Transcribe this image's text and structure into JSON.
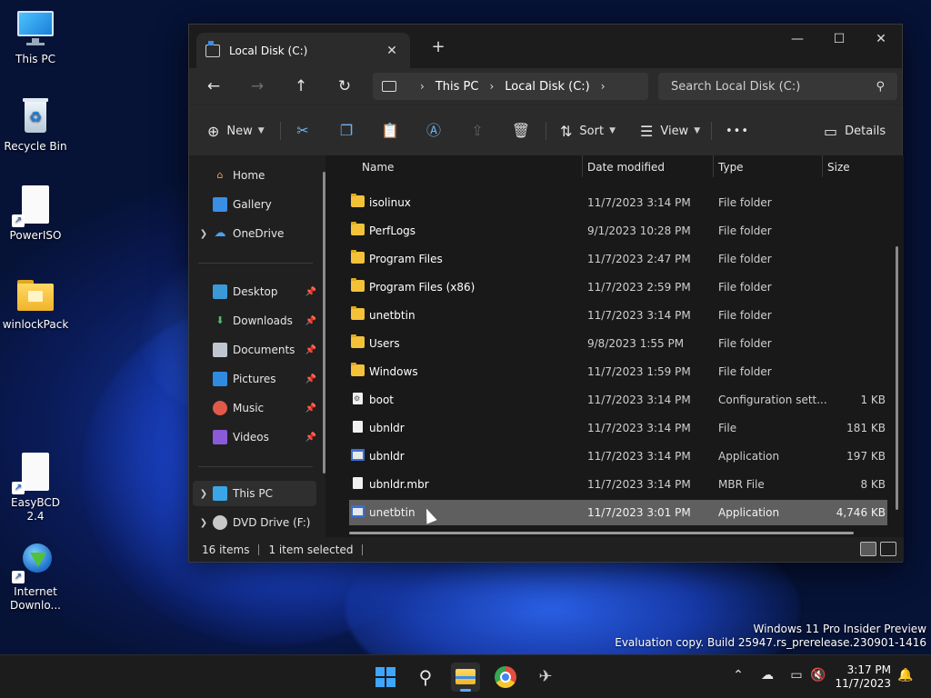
{
  "desktop": {
    "icons": [
      {
        "label": "This PC"
      },
      {
        "label": "Recycle Bin"
      },
      {
        "label": "PowerISO"
      },
      {
        "label": "winlockPack"
      },
      {
        "label": "EasyBCD 2.4"
      },
      {
        "label": "Internet Downlo..."
      }
    ],
    "watermark": {
      "line1": "Windows 11 Pro Insider Preview",
      "line2": "Evaluation copy. Build 25947.rs_prerelease.230901-1416"
    }
  },
  "window": {
    "tab_title": "Local Disk (C:)",
    "tab_close": "✕",
    "new_tab": "+",
    "controls": {
      "minimize": "—",
      "maximize": "☐",
      "close": "✕"
    },
    "nav": {
      "back": "←",
      "forward": "→",
      "up": "↑",
      "refresh": "↻"
    },
    "breadcrumb": [
      "This PC",
      "Local Disk (C:)"
    ],
    "breadcrumb_sep": "›",
    "search_placeholder": "Search Local Disk (C:)",
    "commands": {
      "new": "New",
      "sort": "Sort",
      "view": "View",
      "more": "•••",
      "details": "Details"
    },
    "navpane": {
      "home": "Home",
      "gallery": "Gallery",
      "onedrive": "OneDrive",
      "desktop": "Desktop",
      "downloads": "Downloads",
      "documents": "Documents",
      "pictures": "Pictures",
      "music": "Music",
      "videos": "Videos",
      "thispc": "This PC",
      "dvd": "DVD Drive (F:) sł"
    },
    "columns": {
      "name": "Name",
      "date": "Date modified",
      "type": "Type",
      "size": "Size"
    },
    "files": [
      {
        "name": "isolinux",
        "date": "11/7/2023 3:14 PM",
        "type": "File folder",
        "size": "",
        "icon": "folder"
      },
      {
        "name": "PerfLogs",
        "date": "9/1/2023 10:28 PM",
        "type": "File folder",
        "size": "",
        "icon": "folder"
      },
      {
        "name": "Program Files",
        "date": "11/7/2023 2:47 PM",
        "type": "File folder",
        "size": "",
        "icon": "folder"
      },
      {
        "name": "Program Files (x86)",
        "date": "11/7/2023 2:59 PM",
        "type": "File folder",
        "size": "",
        "icon": "folder"
      },
      {
        "name": "unetbtin",
        "date": "11/7/2023 3:14 PM",
        "type": "File folder",
        "size": "",
        "icon": "folder"
      },
      {
        "name": "Users",
        "date": "9/8/2023 1:55 PM",
        "type": "File folder",
        "size": "",
        "icon": "folder"
      },
      {
        "name": "Windows",
        "date": "11/7/2023 1:59 PM",
        "type": "File folder",
        "size": "",
        "icon": "folder"
      },
      {
        "name": "boot",
        "date": "11/7/2023 3:14 PM",
        "type": "Configuration sett...",
        "size": "1 KB",
        "icon": "config"
      },
      {
        "name": "ubnldr",
        "date": "11/7/2023 3:14 PM",
        "type": "File",
        "size": "181 KB",
        "icon": "file"
      },
      {
        "name": "ubnldr",
        "date": "11/7/2023 3:14 PM",
        "type": "Application",
        "size": "197 KB",
        "icon": "app"
      },
      {
        "name": "ubnldr.mbr",
        "date": "11/7/2023 3:14 PM",
        "type": "MBR File",
        "size": "8 KB",
        "icon": "file"
      },
      {
        "name": "unetbtin",
        "date": "11/7/2023 3:01 PM",
        "type": "Application",
        "size": "4,746 KB",
        "icon": "app",
        "selected": true
      }
    ],
    "status": {
      "count": "16 items",
      "selected": "1 item selected"
    }
  },
  "taskbar": {
    "clock_time": "3:17 PM",
    "clock_date": "11/7/2023"
  },
  "colors": {
    "accent": "#5aa9ff",
    "folder": "#f3c238",
    "window_bg": "#202020"
  }
}
